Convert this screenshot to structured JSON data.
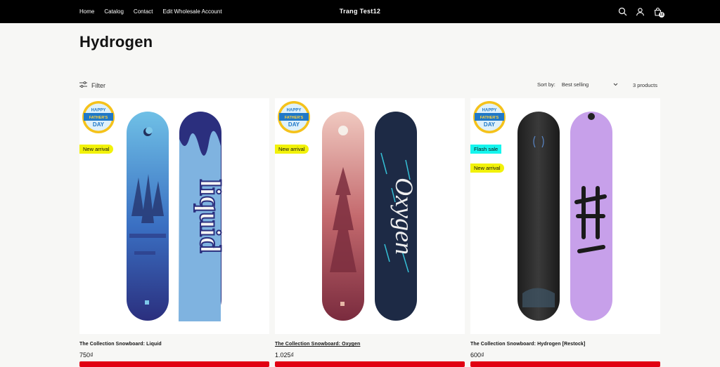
{
  "nav": {
    "items": [
      "Home",
      "Catalog",
      "Contact",
      "Edit Wholesale Account"
    ]
  },
  "brand": "Trang Test12",
  "cart": {
    "count": "11"
  },
  "icons": {
    "search": "search-icon",
    "account": "user-icon",
    "cart": "cart-icon",
    "filter": "filter-sliders-icon",
    "sort": "chevron-down-icon"
  },
  "collection": {
    "title": "Hydrogen"
  },
  "toolbar": {
    "filter_label": "Filter",
    "sort_label": "Sort by:",
    "sort_value": "Best selling",
    "product_count": "3 products"
  },
  "promo_badge": {
    "line1": "HAPPY",
    "line2": "FATHER'S",
    "line3": "DAY"
  },
  "products": [
    {
      "title": "The Collection Snowboard: Liquid",
      "price": "750₫",
      "tags": [
        "New arrival"
      ]
    },
    {
      "title": "The Collection Snowboard: Oxygen",
      "price": "1.025₫",
      "tags": [
        "New arrival"
      ]
    },
    {
      "title": "The Collection Snowboard: Hydrogen [Restock]",
      "price": "600₫",
      "tags": [
        "Flash sale",
        "New arrival"
      ]
    }
  ],
  "colors": {
    "header_bg": "#000000",
    "new_arrival": "#f2f20a",
    "flash_sale": "#16f5ee",
    "button_red": "#e10012"
  }
}
